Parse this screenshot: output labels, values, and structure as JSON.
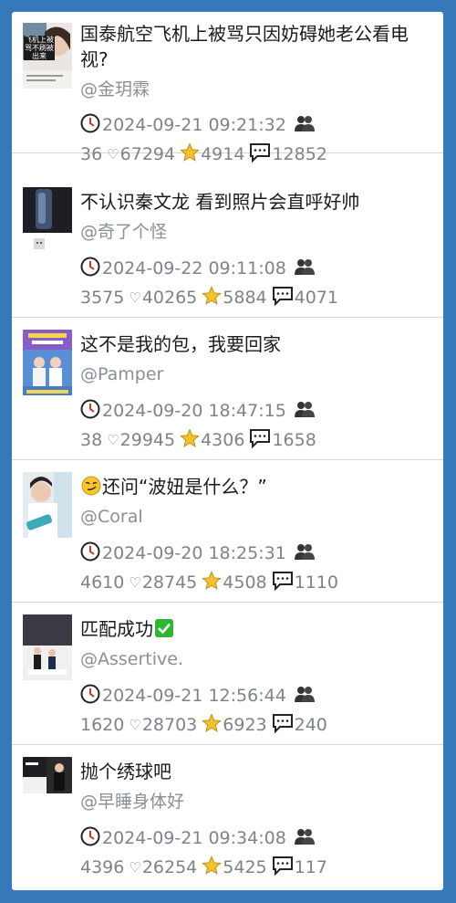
{
  "posts": [
    {
      "title": "国泰航空飞机上被骂只因妨碍她老公看电视?",
      "author": "@金玥霖",
      "timestamp": "2024-09-21 09:21:32",
      "views": "36",
      "likes": "67294",
      "favorites": "4914",
      "comments": "12852",
      "thumb_caption": "飞机上被骂不刷被出来"
    },
    {
      "title": "不认识秦文龙 看到照片会直呼好帅",
      "author": "@奇了个怪",
      "timestamp": "2024-09-22 09:11:08",
      "views": "3575",
      "likes": "40265",
      "favorites": "5884",
      "comments": "4071"
    },
    {
      "title": "这不是我的包，我要回家",
      "author": "@Pamper",
      "timestamp": "2024-09-20 18:47:15",
      "views": "38",
      "likes": "29945",
      "favorites": "4306",
      "comments": "1658"
    },
    {
      "title": "还问“波妞是什么？”",
      "author": "@Coral",
      "timestamp": "2024-09-20 18:25:31",
      "views": "4610",
      "likes": "28745",
      "favorites": "4508",
      "comments": "1110"
    },
    {
      "title": "匹配成功",
      "author": "@Assertive.",
      "timestamp": "2024-09-21 12:56:44",
      "views": "1620",
      "likes": "28703",
      "favorites": "6923",
      "comments": "240"
    },
    {
      "title": "抛个绣球吧",
      "author": "@早睡身体好",
      "timestamp": "2024-09-21 09:34:08",
      "views": "4396",
      "likes": "26254",
      "favorites": "5425",
      "comments": "117"
    }
  ],
  "icons": {
    "clock": "clock-icon",
    "people": "people-icon",
    "heart": "heart-icon",
    "star": "star-icon",
    "comment": "comment-icon"
  },
  "colors": {
    "background": "#3579b8",
    "panel": "#ffffff",
    "star": "#f2c12e",
    "check": "#2fb52f"
  }
}
